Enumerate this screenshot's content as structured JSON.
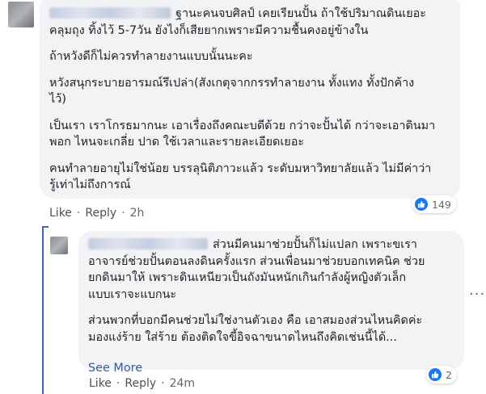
{
  "comment1": {
    "text_lines": [
      [
        "ฐานะคนจบศิลป์ เคยเรียนปั้น ถ้าใช้ปริมาณดินเยอะ",
        "คลุมถุง ทิ้งไว้ 5-7วัน ยังไงก็เสียยากเพราะมีความชื้นคงอยู่ข้างใน"
      ],
      [
        "ถ้าหวังดีก็ไม่ควรทำลายงานแบบนั้นนะคะ"
      ],
      [
        "หวังสนุกระบายอารมณ์รึเปล่า(สังเกตุจากกรรทำลายงาน ทั้งแทง ทั้งปักค้าง",
        "ไว้)"
      ],
      [
        "เป็นเรา เราโกรธมากนะ เอาเรื่องถึงคณะบดีด้วย กว่าจะปั้นได้ กว่าจะเอาดินมา",
        "พอก ไหนจะเกลี่ย ปาด ใช้เวลาและรายละเอียดเยอะ"
      ],
      [
        "คนทำลายอายุไม่ใช่น้อย บรรลุนิติภาวะแล้ว ระดับมหาวิทยาลัยแล้ว ไม่มีค่าว่า",
        "รู้เท่าไม่ถึงการณ์"
      ]
    ],
    "reaction_count": "149",
    "like_label": "Like",
    "reply_label": "Reply",
    "time": "2h"
  },
  "comment2": {
    "text_lines": [
      [
        "ส่วนมีคนมาช่วยปั้นก็ไม่แปลก เพราะขเรา",
        "อาจารย์ช่วยปั้นตอนลงดินครั้งแรก ส่วนเพื่อนมาช่วยบอกเทคนิค ช่วย",
        "ยกดินมาให้ เพราะดินเหนียวเป็นถังมันหนักเกินกำลังผู้หญิงตัวเล็ก",
        "แบบเราจะแบกนะ"
      ],
      [
        "ส่วนพวกที่บอกมีคนช่วยไม่ใช่งานตัวเอง คือ เอาสมองส่วนไหนคิดค่ะ",
        "มองแง่ร้าย ใส่ร้าย ต้องติดใจขี้อิจฉาขนาดไหนถึงคิดเช่นนี้ได้..."
      ]
    ],
    "see_more": "See More",
    "reaction_count": "2",
    "like_label": "Like",
    "reply_label": "Reply",
    "time": "24m"
  },
  "colors": {
    "bubble": "#f2f3f5",
    "link": "#385898",
    "like_blue": "#1877f2",
    "reply_rail": "#4267b2"
  },
  "icons": {
    "like": "thumbs-up-icon",
    "more": "more-options-icon"
  }
}
